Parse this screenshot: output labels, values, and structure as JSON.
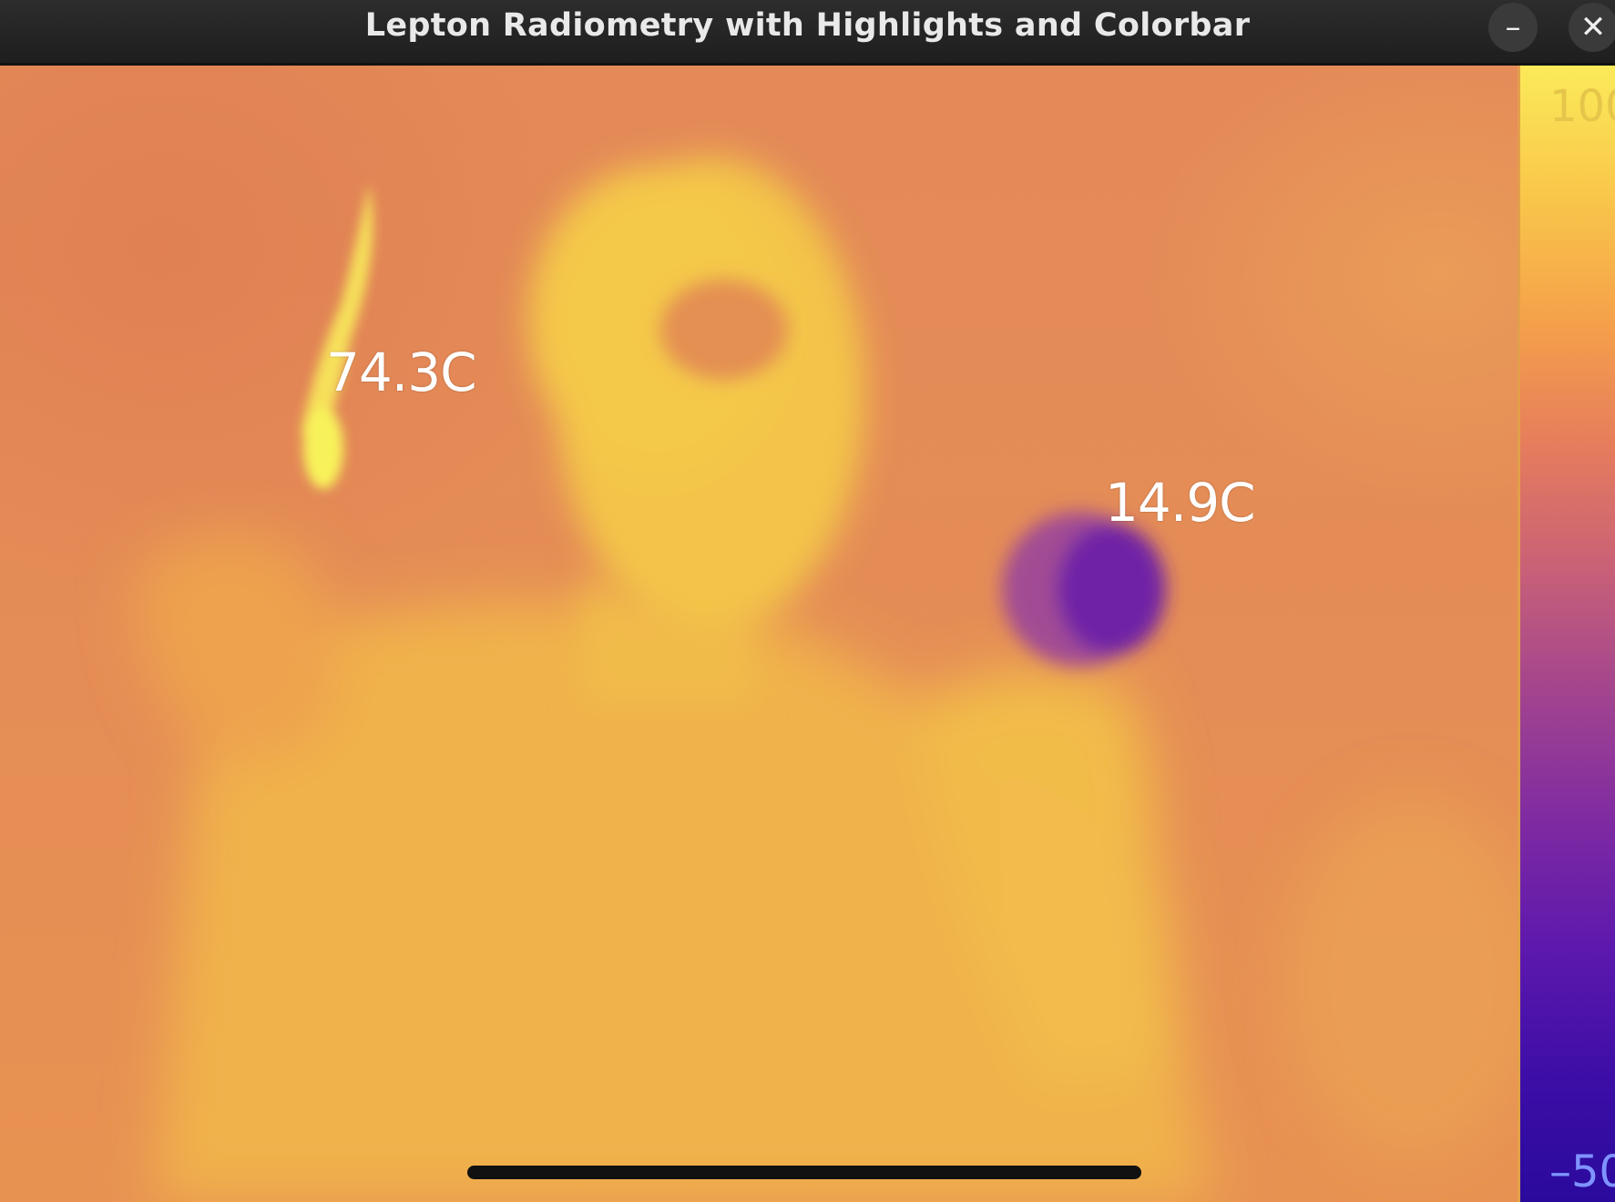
{
  "window": {
    "title": "Lepton Radiometry with Highlights and Colorbar",
    "minimize_symbol": "–",
    "close_symbol": "✕"
  },
  "readouts": [
    {
      "text": "74.3C",
      "kind": "hotspot"
    },
    {
      "text": "14.9C",
      "kind": "coldspot"
    }
  ],
  "colorbar": {
    "max_label": "100",
    "min_label": "–50",
    "colors": [
      "#fbea5a",
      "#f9c84a",
      "#f5a24a",
      "#e67d5c",
      "#c86078",
      "#a1438f",
      "#7e2aa2",
      "#5d18ad",
      "#3d0ea7",
      "#2a0a9c"
    ]
  },
  "palette": {
    "background": "#e48a58",
    "body": "#f0b54a",
    "hot": "#f8f25a",
    "cold": "#7a2aa8"
  }
}
